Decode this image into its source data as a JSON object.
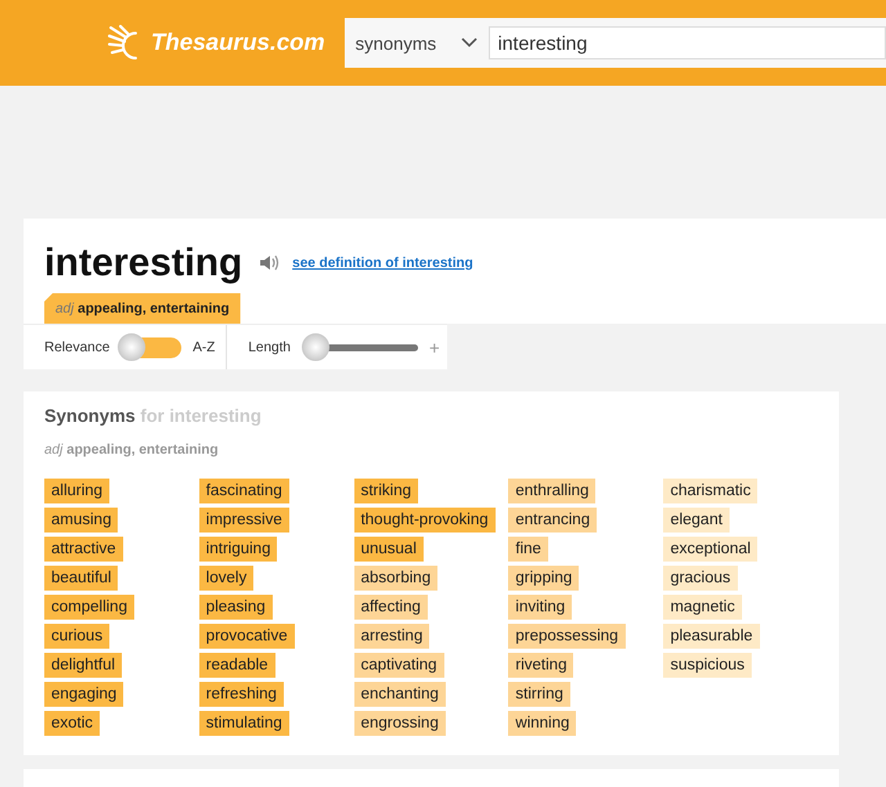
{
  "header": {
    "logo": "Thesaurus.com",
    "search_type": "synonyms",
    "search_value": "interesting"
  },
  "word": {
    "title": "interesting",
    "definition_link": "see definition of interesting",
    "tab": {
      "pos": "adj",
      "sense": "appealing, entertaining",
      "selected": true
    }
  },
  "filters": {
    "sort_left": "Relevance",
    "sort_right": "A-Z",
    "sort_on": false,
    "length_label": "Length",
    "length_slider": {
      "level": 0
    },
    "length_plus": "+"
  },
  "synonyms": {
    "heading": "Synonyms",
    "heading_suffix": "for interesting",
    "pos": "adj",
    "sense": "appealing, entertaining",
    "columns": [
      [
        {
          "text": "alluring",
          "color": "#fbb843"
        },
        {
          "text": "amusing",
          "color": "#fbb843"
        },
        {
          "text": "attractive",
          "color": "#fbb843"
        },
        {
          "text": "beautiful",
          "color": "#fbb843"
        },
        {
          "text": "compelling",
          "color": "#fbb843"
        },
        {
          "text": "curious",
          "color": "#fbb843"
        },
        {
          "text": "delightful",
          "color": "#fbb843"
        },
        {
          "text": "engaging",
          "color": "#fbb843"
        },
        {
          "text": "exotic",
          "color": "#fbb843"
        }
      ],
      [
        {
          "text": "fascinating",
          "color": "#fbb843"
        },
        {
          "text": "impressive",
          "color": "#fbb843"
        },
        {
          "text": "intriguing",
          "color": "#fbb843"
        },
        {
          "text": "lovely",
          "color": "#fbb843"
        },
        {
          "text": "pleasing",
          "color": "#fbb843"
        },
        {
          "text": "provocative",
          "color": "#fbb843"
        },
        {
          "text": "readable",
          "color": "#fbb843"
        },
        {
          "text": "refreshing",
          "color": "#fbb843"
        },
        {
          "text": "stimulating",
          "color": "#fbb843"
        }
      ],
      [
        {
          "text": "striking",
          "color": "#fbb843"
        },
        {
          "text": "thought-provoking",
          "color": "#fbb843"
        },
        {
          "text": "unusual",
          "color": "#fbb843"
        },
        {
          "text": "absorbing",
          "color": "#fdd596"
        },
        {
          "text": "affecting",
          "color": "#fdd596"
        },
        {
          "text": "arresting",
          "color": "#fdd596"
        },
        {
          "text": "captivating",
          "color": "#fdd596"
        },
        {
          "text": "enchanting",
          "color": "#fdd596"
        },
        {
          "text": "engrossing",
          "color": "#fdd596"
        }
      ],
      [
        {
          "text": "enthralling",
          "color": "#fdd596"
        },
        {
          "text": "entrancing",
          "color": "#fdd596"
        },
        {
          "text": "fine",
          "color": "#fdd596"
        },
        {
          "text": "gripping",
          "color": "#fdd596"
        },
        {
          "text": "inviting",
          "color": "#fdd596"
        },
        {
          "text": "prepossessing",
          "color": "#fdd596"
        },
        {
          "text": "riveting",
          "color": "#fdd596"
        },
        {
          "text": "stirring",
          "color": "#fdd596"
        },
        {
          "text": "winning",
          "color": "#fdd596"
        }
      ],
      [
        {
          "text": "charismatic",
          "color": "#feeac6"
        },
        {
          "text": "elegant",
          "color": "#feeac6"
        },
        {
          "text": "exceptional",
          "color": "#feeac6"
        },
        {
          "text": "gracious",
          "color": "#feeac6"
        },
        {
          "text": "magnetic",
          "color": "#feeac6"
        },
        {
          "text": "pleasurable",
          "color": "#feeac6"
        },
        {
          "text": "suspicious",
          "color": "#feeac6"
        }
      ]
    ]
  }
}
